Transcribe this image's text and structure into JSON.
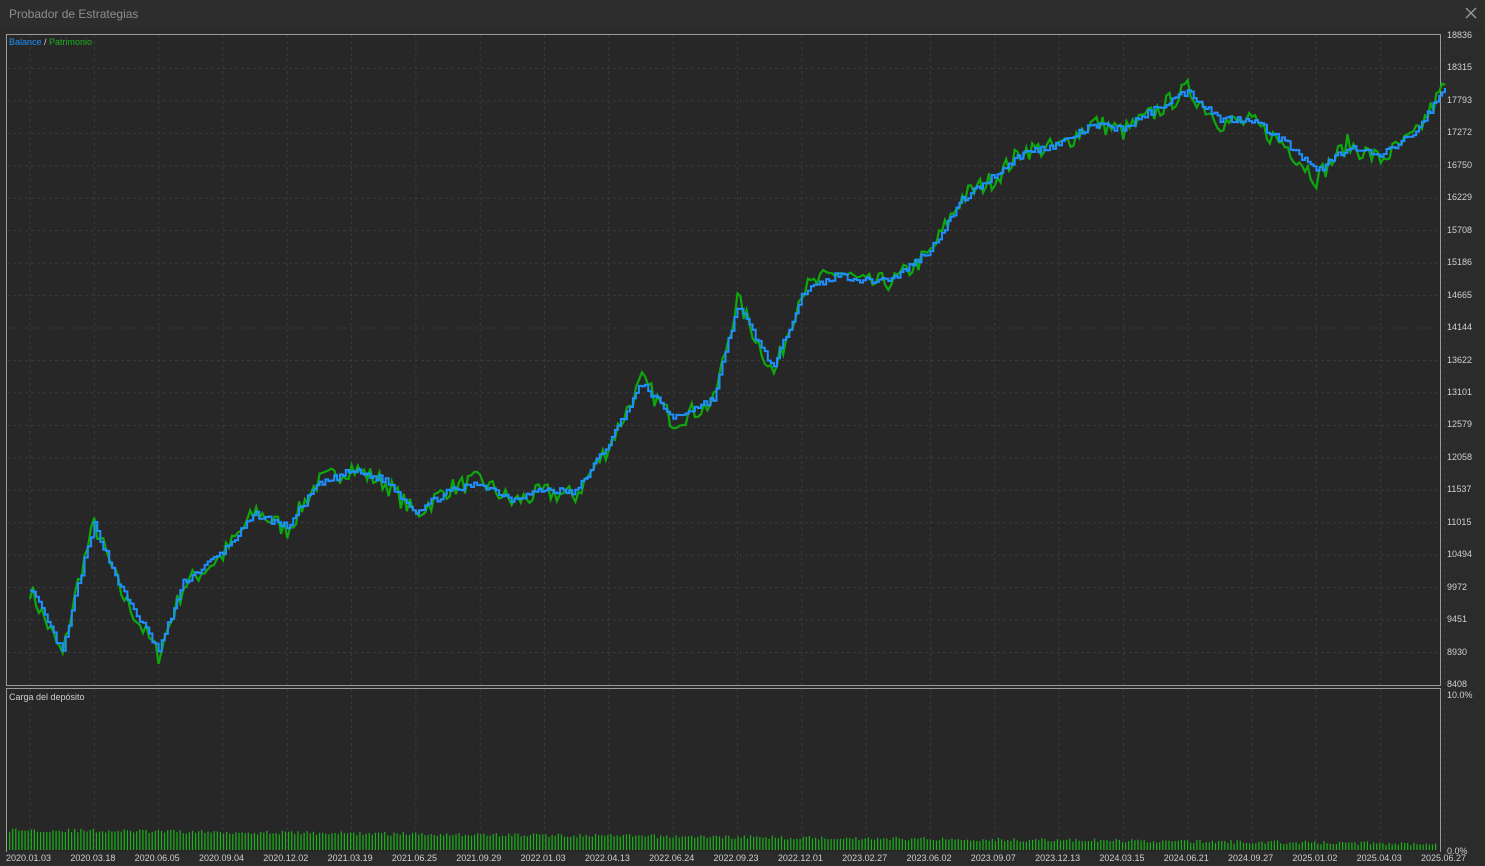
{
  "window": {
    "title": "Probador de Estrategias"
  },
  "colors": {
    "balance": "#1e90ff",
    "equity": "#0ea80e",
    "load": "#19b319",
    "grid": "#3a3a3a",
    "text": "#d0d0d0"
  },
  "icons": {
    "close": "close-icon"
  },
  "balance_chart": {
    "legend_balance": "Balance",
    "legend_separator": " / ",
    "legend_equity": "Patrimonio"
  },
  "deposit_chart": {
    "title": "Carga del depósito"
  },
  "chart_data": [
    {
      "type": "line",
      "title": "",
      "xlabel": "",
      "ylabel": "",
      "ylim": [
        8408,
        18836
      ],
      "y_ticks": [
        "18836",
        "18315",
        "17793",
        "17272",
        "16750",
        "16229",
        "15708",
        "15186",
        "14665",
        "14144",
        "13622",
        "13101",
        "12579",
        "12058",
        "11537",
        "11015",
        "10494",
        "9972",
        "9451",
        "8930",
        "8408"
      ],
      "x_ticks": [
        "2020.01.03",
        "2020.03.18",
        "2020.06.05",
        "2020.09.04",
        "2020.12.02",
        "2021.03.19",
        "2021.06.25",
        "2021.09.29",
        "2022.01.03",
        "2022.04.13",
        "2022.06.24",
        "2022.09.23",
        "2022.12.01",
        "2023.02.27",
        "2023.06.02",
        "2023.09.07",
        "2023.12.13",
        "2024.03.15",
        "2024.06.21",
        "2024.09.27",
        "2025.01.02",
        "2025.04.03",
        "2025.06.27"
      ],
      "series": [
        {
          "name": "Balance",
          "x": [
            "2020.01.03",
            "2020.02.10",
            "2020.02.28",
            "2020.03.18",
            "2020.04.20",
            "2020.06.05",
            "2020.07.10",
            "2020.09.04",
            "2020.10.20",
            "2020.12.02",
            "2021.01.20",
            "2021.03.19",
            "2021.05.10",
            "2021.06.25",
            "2021.08.10",
            "2021.09.29",
            "2021.11.15",
            "2022.01.03",
            "2022.02.20",
            "2022.04.13",
            "2022.05.20",
            "2022.06.24",
            "2022.08.20",
            "2022.09.23",
            "2022.11.01",
            "2022.12.01",
            "2023.01.20",
            "2023.02.27",
            "2023.04.10",
            "2023.06.02",
            "2023.07.20",
            "2023.09.07",
            "2023.10.20",
            "2023.12.13",
            "2024.02.01",
            "2024.03.15",
            "2024.05.01",
            "2024.06.21",
            "2024.08.10",
            "2024.09.27",
            "2024.11.20",
            "2025.01.02",
            "2025.02.15",
            "2025.04.03",
            "2025.05.20",
            "2025.06.27"
          ],
          "y": [
            9980,
            8930,
            10020,
            10980,
            9950,
            8960,
            10050,
            10550,
            11150,
            10950,
            11600,
            11850,
            11700,
            11200,
            11500,
            11650,
            11400,
            11550,
            11500,
            12300,
            13250,
            12700,
            13000,
            14500,
            13500,
            14700,
            15000,
            14900,
            14950,
            15400,
            16200,
            16600,
            16950,
            17100,
            17400,
            17350,
            17650,
            17950,
            17500,
            17500,
            17100,
            16650,
            17050,
            16900,
            17300,
            18000
          ]
        },
        {
          "name": "Patrimonio",
          "x": [
            "2020.01.03",
            "2020.02.10",
            "2020.02.28",
            "2020.03.18",
            "2020.04.20",
            "2020.06.05",
            "2020.07.10",
            "2020.09.04",
            "2020.10.20",
            "2020.12.02",
            "2021.01.20",
            "2021.03.19",
            "2021.05.10",
            "2021.06.25",
            "2021.08.10",
            "2021.09.29",
            "2021.11.15",
            "2022.01.03",
            "2022.02.20",
            "2022.04.13",
            "2022.05.20",
            "2022.06.24",
            "2022.08.20",
            "2022.09.23",
            "2022.11.01",
            "2022.12.01",
            "2023.01.20",
            "2023.02.27",
            "2023.04.10",
            "2023.06.02",
            "2023.07.20",
            "2023.09.07",
            "2023.10.20",
            "2023.12.13",
            "2024.02.01",
            "2024.03.15",
            "2024.05.01",
            "2024.06.21",
            "2024.08.10",
            "2024.09.27",
            "2024.11.20",
            "2025.01.02",
            "2025.02.15",
            "2025.04.03",
            "2025.05.20",
            "2025.06.27"
          ],
          "y": [
            9950,
            8880,
            10050,
            11000,
            9900,
            8890,
            10000,
            10500,
            11200,
            10900,
            11650,
            11900,
            11650,
            11150,
            11550,
            11700,
            11350,
            11500,
            11450,
            12250,
            13300,
            12650,
            12950,
            14600,
            13400,
            14750,
            15050,
            14850,
            14900,
            15350,
            16250,
            16550,
            17000,
            17050,
            17450,
            17300,
            17600,
            17980,
            17450,
            17450,
            17050,
            16550,
            17100,
            16850,
            17250,
            18050
          ]
        }
      ]
    },
    {
      "type": "bar",
      "title": "Carga del depósito",
      "ylim": [
        0,
        10
      ],
      "y_ticks": [
        "10.0%",
        "0.0%"
      ],
      "values_percent_range": [
        0.4,
        1.3
      ]
    }
  ]
}
